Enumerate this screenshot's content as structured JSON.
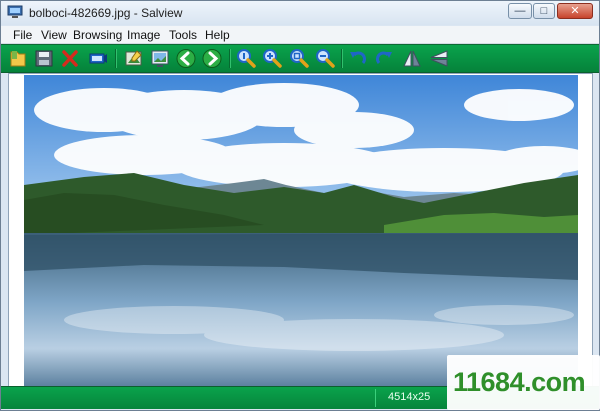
{
  "window": {
    "title": "bolboci-482669.jpg - Salview",
    "minimize_glyph": "—",
    "maximize_glyph": "□",
    "close_glyph": "✕"
  },
  "menu": {
    "items": [
      "File",
      "View",
      "Browsing",
      "Image",
      "Tools",
      "Help"
    ]
  },
  "toolbar": {
    "icons": [
      "open-folder-icon",
      "save-icon",
      "delete-icon",
      "slideshow-icon",
      "edit-image-icon",
      "wallpaper-icon",
      "previous-icon",
      "next-icon",
      "zoom-actual-icon",
      "zoom-in-icon",
      "zoom-fit-icon",
      "zoom-out-icon",
      "rotate-left-icon",
      "rotate-right-icon",
      "flip-horizontal-icon",
      "flip-vertical-icon"
    ]
  },
  "image": {
    "description_name": "lake-mountain-photo"
  },
  "status": {
    "dimensions": "4514x25"
  },
  "watermark": {
    "text": "11684.com"
  },
  "colors": {
    "toolbar_green": "#07913f",
    "accent_blue": "#1f66c7",
    "arrow_green": "#22a33c"
  }
}
